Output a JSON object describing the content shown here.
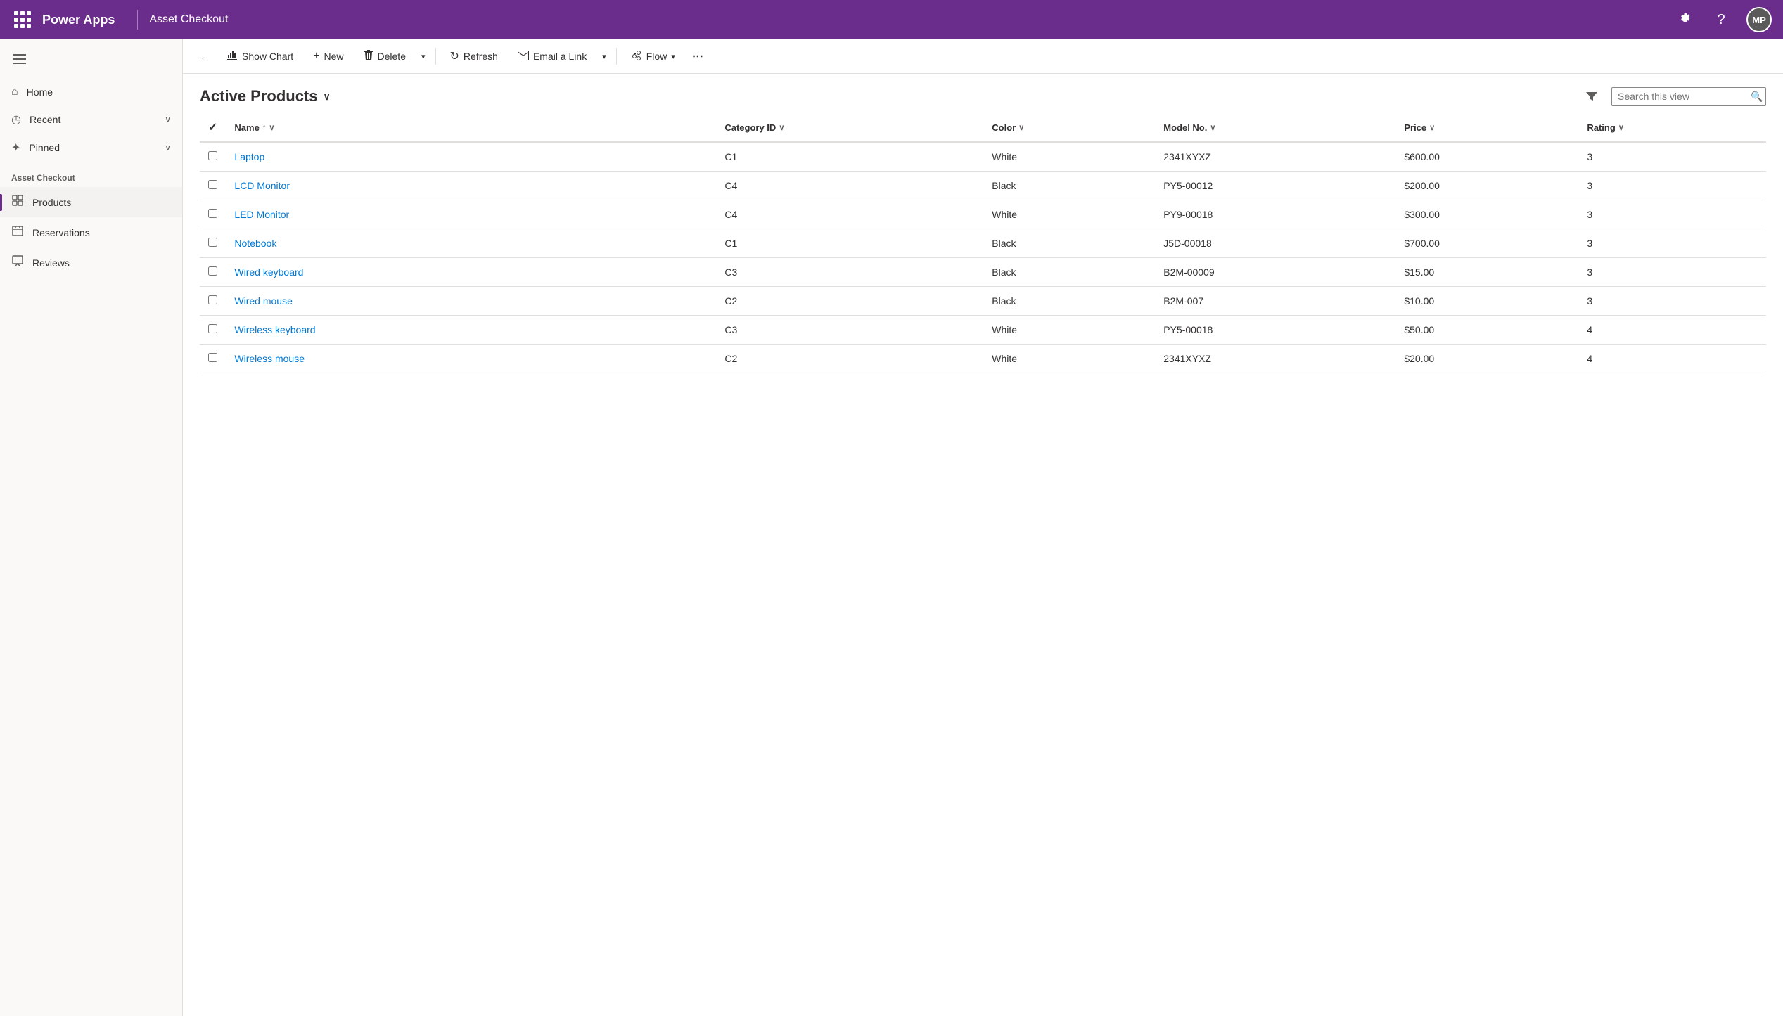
{
  "topbar": {
    "app_name": "Power Apps",
    "page_title": "Asset Checkout",
    "avatar_initials": "MP",
    "settings_label": "Settings",
    "help_label": "Help"
  },
  "toolbar": {
    "back_label": "←",
    "show_chart_label": "Show Chart",
    "new_label": "New",
    "delete_label": "Delete",
    "refresh_label": "Refresh",
    "email_link_label": "Email a Link",
    "flow_label": "Flow",
    "more_label": "⋯"
  },
  "sidebar": {
    "home_label": "Home",
    "recent_label": "Recent",
    "pinned_label": "Pinned",
    "section_title": "Asset Checkout",
    "nav_items": [
      {
        "id": "products",
        "label": "Products",
        "active": true
      },
      {
        "id": "reservations",
        "label": "Reservations",
        "active": false
      },
      {
        "id": "reviews",
        "label": "Reviews",
        "active": false
      }
    ]
  },
  "list": {
    "title": "Active Products",
    "search_placeholder": "Search this view",
    "columns": [
      {
        "id": "name",
        "label": "Name",
        "sort": "asc"
      },
      {
        "id": "category_id",
        "label": "Category ID"
      },
      {
        "id": "color",
        "label": "Color"
      },
      {
        "id": "model_no",
        "label": "Model No."
      },
      {
        "id": "price",
        "label": "Price"
      },
      {
        "id": "rating",
        "label": "Rating"
      }
    ],
    "rows": [
      {
        "name": "Laptop",
        "category_id": "C1",
        "color": "White",
        "model_no": "2341XYXZ",
        "price": "$600.00",
        "rating": "3"
      },
      {
        "name": "LCD Monitor",
        "category_id": "C4",
        "color": "Black",
        "model_no": "PY5-00012",
        "price": "$200.00",
        "rating": "3"
      },
      {
        "name": "LED Monitor",
        "category_id": "C4",
        "color": "White",
        "model_no": "PY9-00018",
        "price": "$300.00",
        "rating": "3"
      },
      {
        "name": "Notebook",
        "category_id": "C1",
        "color": "Black",
        "model_no": "J5D-00018",
        "price": "$700.00",
        "rating": "3"
      },
      {
        "name": "Wired keyboard",
        "category_id": "C3",
        "color": "Black",
        "model_no": "B2M-00009",
        "price": "$15.00",
        "rating": "3"
      },
      {
        "name": "Wired mouse",
        "category_id": "C2",
        "color": "Black",
        "model_no": "B2M-007",
        "price": "$10.00",
        "rating": "3"
      },
      {
        "name": "Wireless keyboard",
        "category_id": "C3",
        "color": "White",
        "model_no": "PY5-00018",
        "price": "$50.00",
        "rating": "4"
      },
      {
        "name": "Wireless mouse",
        "category_id": "C2",
        "color": "White",
        "model_no": "2341XYXZ",
        "price": "$20.00",
        "rating": "4"
      }
    ]
  },
  "colors": {
    "brand": "#6b2d8b",
    "link": "#0078d4",
    "text_primary": "#323130",
    "text_secondary": "#605e5c"
  }
}
